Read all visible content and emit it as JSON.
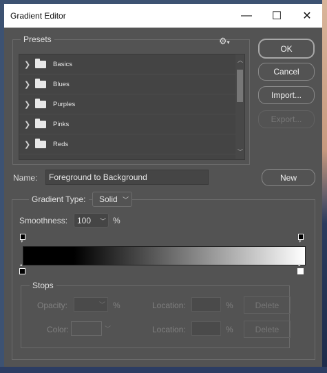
{
  "window": {
    "title": "Gradient Editor"
  },
  "title_buttons": {
    "minimize": "—",
    "maximize": "☐",
    "close": "✕"
  },
  "presets": {
    "label": "Presets",
    "settings_icon": "gear-icon",
    "items": [
      {
        "label": "Basics"
      },
      {
        "label": "Blues"
      },
      {
        "label": "Purples"
      },
      {
        "label": "Pinks"
      },
      {
        "label": "Reds"
      }
    ]
  },
  "buttons": {
    "ok": "OK",
    "cancel": "Cancel",
    "import": "Import...",
    "export": "Export...",
    "new": "New"
  },
  "name": {
    "label": "Name:",
    "value": "Foreground to Background"
  },
  "gradient_type": {
    "label": "Gradient Type:",
    "value": "Solid"
  },
  "smoothness": {
    "label": "Smoothness:",
    "value": "100",
    "unit": "%"
  },
  "gradient": {
    "start_color": "#000000",
    "end_color": "#ffffff"
  },
  "stops": {
    "label": "Stops",
    "opacity_label": "Opacity:",
    "opacity_unit": "%",
    "location_label": "Location:",
    "location_unit": "%",
    "color_label": "Color:",
    "delete_label": "Delete"
  },
  "colors": {
    "dialog_bg": "#535353",
    "titlebar_bg": "#ffffff",
    "list_bg": "#444444"
  }
}
